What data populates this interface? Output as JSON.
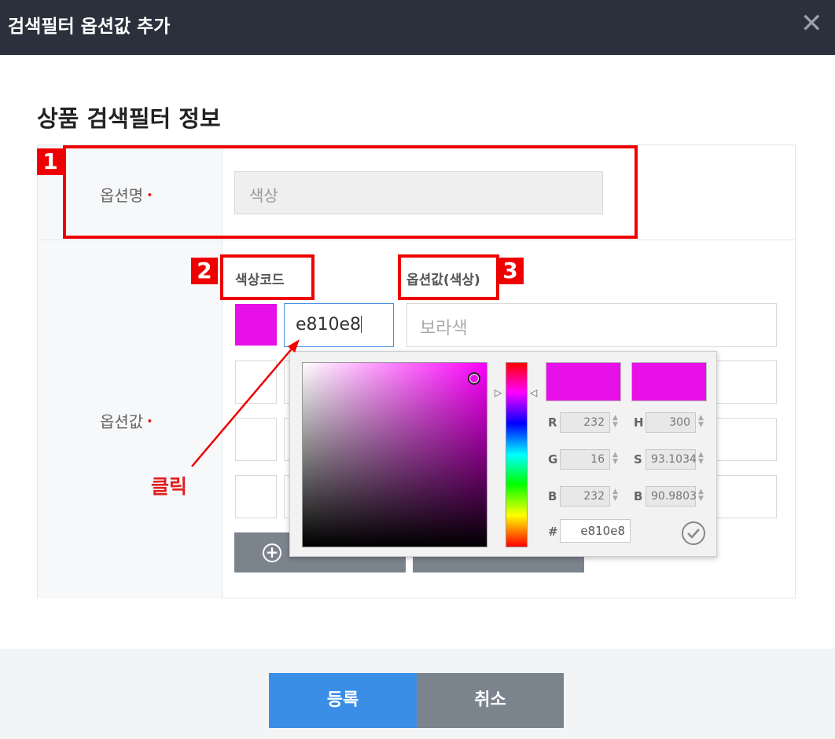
{
  "dialog": {
    "title": "검색필터 옵션값 추가",
    "close_icon": "close-icon"
  },
  "section": {
    "title": "상품 검색필터 정보"
  },
  "form": {
    "option_name": {
      "label": "옵션명",
      "required_mark": "•",
      "value": "색상"
    },
    "option_values": {
      "label": "옵션값",
      "required_mark": "•",
      "color_code_header": "색상코드",
      "value_header": "옵션값(색상)",
      "first_row": {
        "color_code": "e810e8",
        "value_placeholder": "보라색",
        "swatch_color": "#e810e8"
      }
    }
  },
  "color_picker": {
    "current_color": "#e810e8",
    "fields": {
      "r_label": "R",
      "r": "232",
      "g_label": "G",
      "g": "16",
      "b_label": "B",
      "b": "232",
      "h_label": "H",
      "h": "300",
      "s_label": "S",
      "s": "93.1034",
      "v_label": "B",
      "v": "90.9803",
      "hex_label": "#",
      "hex": "e810e8"
    }
  },
  "buttons": {
    "submit": "등록",
    "cancel": "취소"
  },
  "annotations": {
    "badge1": "1",
    "badge2": "2",
    "badge3": "3",
    "click_label": "클릭",
    "highlight_color": "#ee0000"
  }
}
